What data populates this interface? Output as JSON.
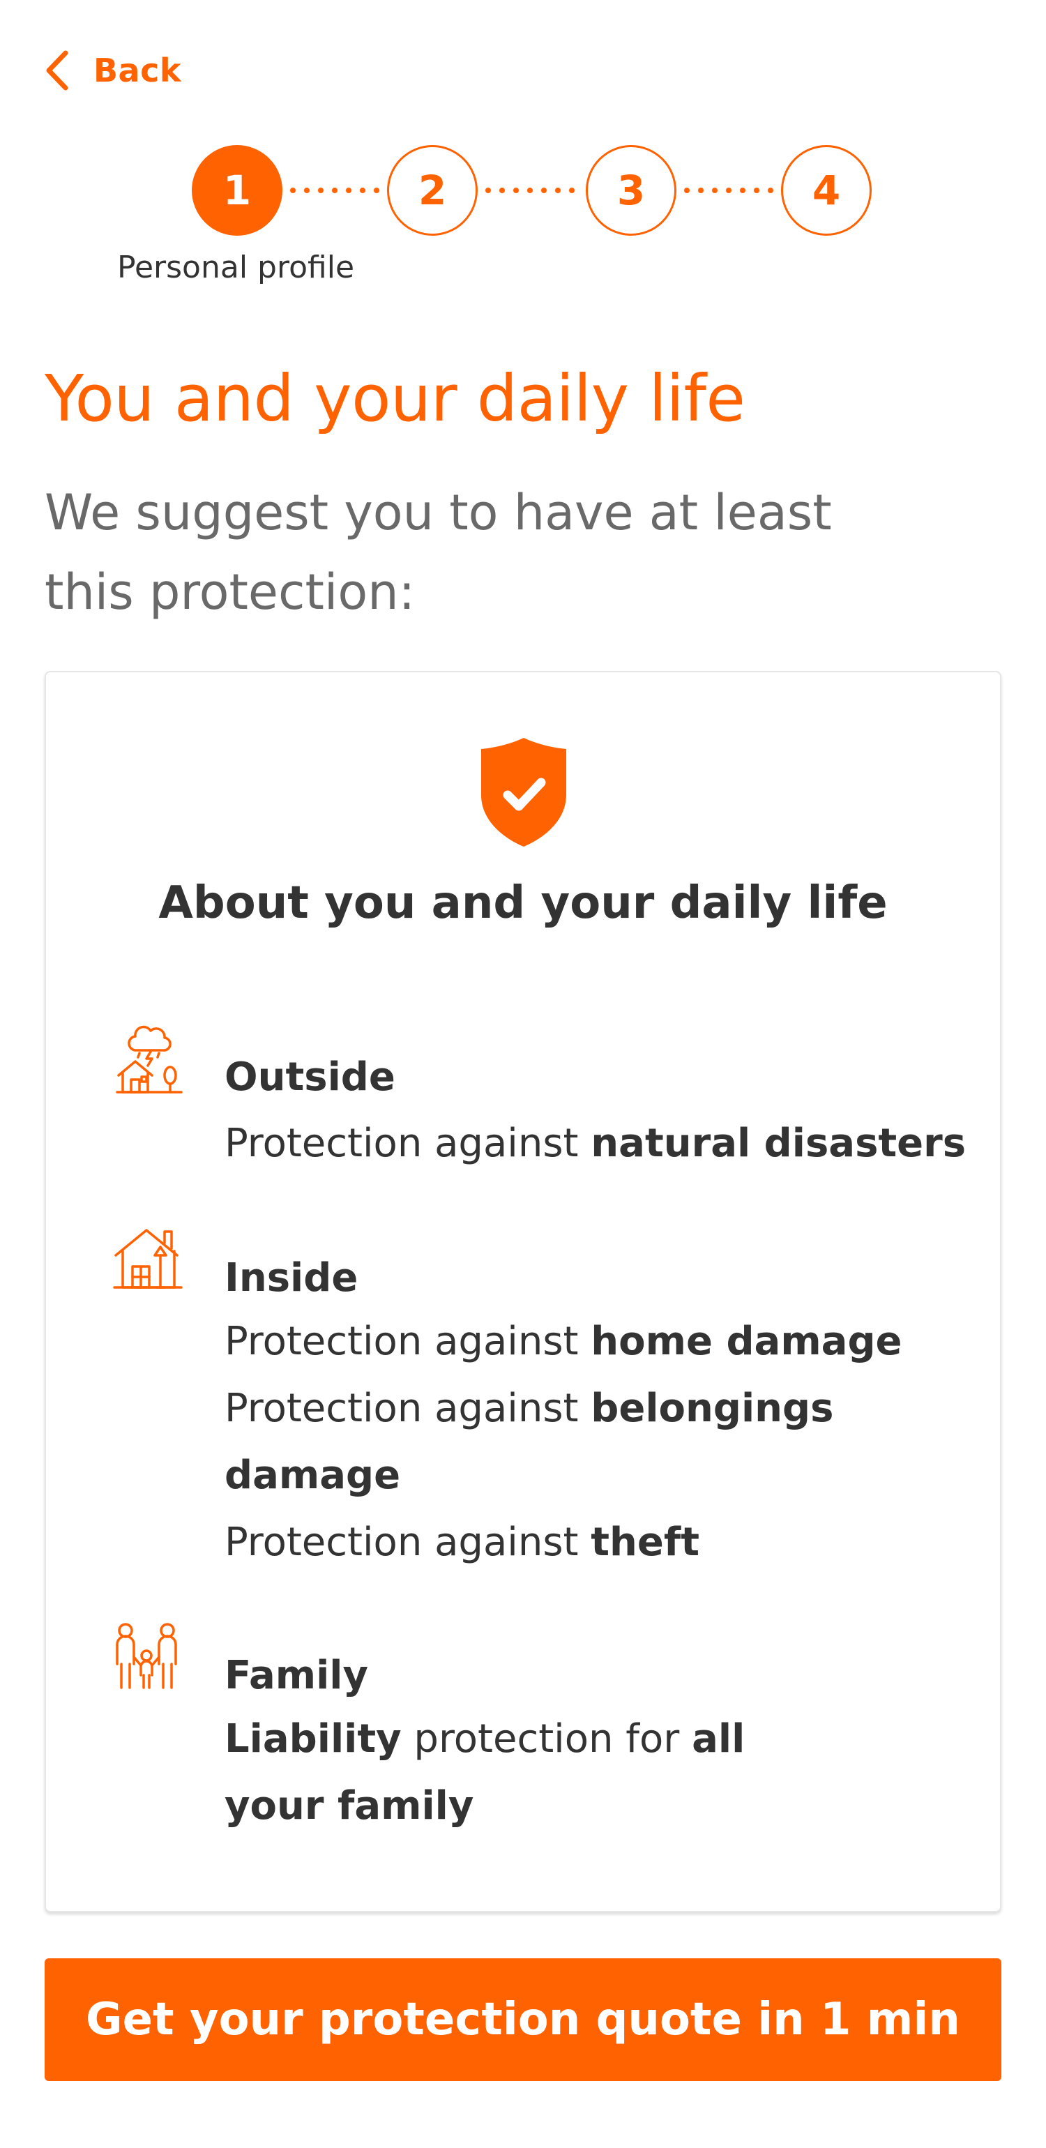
{
  "nav": {
    "back_label": "Back"
  },
  "stepper": {
    "steps": [
      "1",
      "2",
      "3",
      "4"
    ],
    "current_step": 1,
    "current_label": "Personal profile"
  },
  "page": {
    "title": "You and your daily life",
    "subtitle": "We suggest you to have at least this protection:"
  },
  "card": {
    "icon": "shield-check-icon",
    "title": "About you and your daily life",
    "outside": {
      "icon": "house-storm-icon",
      "title": "Outside",
      "line1_prefix": "Protection against ",
      "line1_bold": "natural disasters"
    },
    "inside": {
      "icon": "house-interior-icon",
      "title": "Inside",
      "line1_prefix": "Protection against ",
      "line1_bold": "home damage",
      "line2_prefix": "Protection against ",
      "line2_bold": "belongings damage",
      "line3_prefix": "Protection against ",
      "line3_bold": "theft"
    },
    "family": {
      "icon": "family-icon",
      "title": "Family",
      "bold1": "Liability",
      "mid": " protection for ",
      "bold2": "all your family"
    }
  },
  "cta": {
    "label": "Get your protection quote in 1 min"
  },
  "colors": {
    "accent": "#ff6200",
    "text": "#333333",
    "muted": "#696969"
  }
}
